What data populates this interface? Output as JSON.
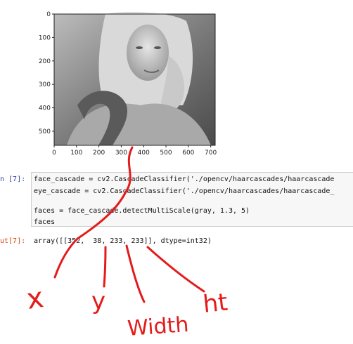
{
  "plot": {
    "x_ticks": [
      "0",
      "100",
      "200",
      "300",
      "400",
      "500",
      "600",
      "700"
    ],
    "y_ticks": [
      "0",
      "100",
      "200",
      "300",
      "400",
      "500"
    ]
  },
  "cell": {
    "in_prompt": "n [7]:",
    "lines": [
      "face_cascade = cv2.CascadeClassifier('./opencv/haarcascades/haarcascade",
      "eye_cascade = cv2.CascadeClassifier('./opencv/haarcascades/haarcascade_",
      "",
      "faces = face_cascade.detectMultiScale(gray, 1.3, 5)",
      "faces"
    ],
    "out_prompt": "ut[7]:",
    "output": "array([[352,  38, 233, 233]], dtype=int32)"
  },
  "annotations": {
    "x_label": "x",
    "y_label": "y",
    "width_label": "Width",
    "ht_label": "ht",
    "color": "#e31b1b"
  }
}
